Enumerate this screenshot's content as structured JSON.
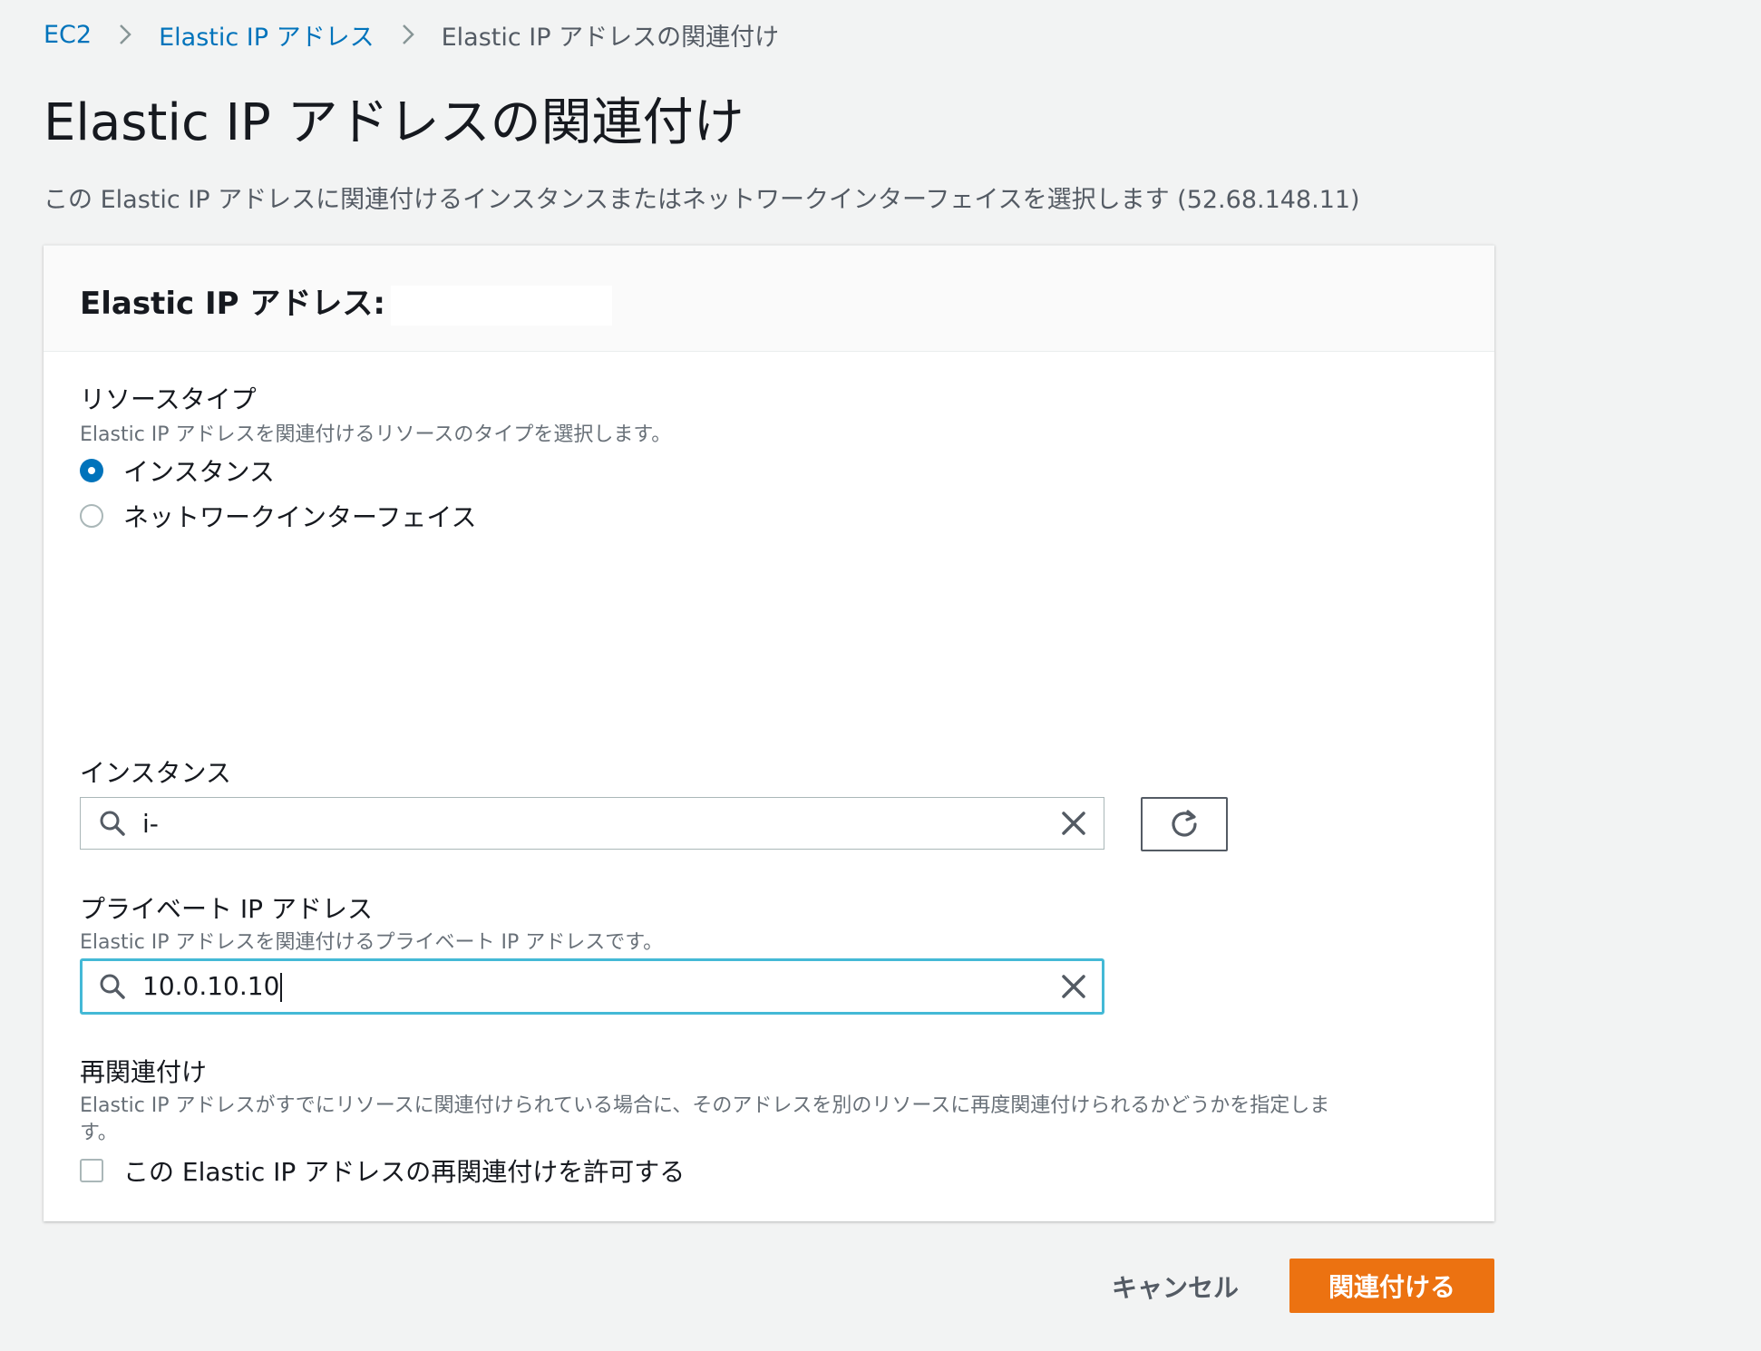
{
  "breadcrumb": {
    "items": [
      "EC2",
      "Elastic IP アドレス",
      "Elastic IP アドレスの関連付け"
    ]
  },
  "page": {
    "title": "Elastic IP アドレスの関連付け",
    "description": "この Elastic IP アドレスに関連付けるインスタンスまたはネットワークインターフェイスを選択します (52.68.148.11)"
  },
  "panel": {
    "title": "Elastic IP アドレス:"
  },
  "resource_type": {
    "label": "リソースタイプ",
    "description": "Elastic IP アドレスを関連付けるリソースのタイプを選択します。",
    "options": [
      "インスタンス",
      "ネットワークインターフェイス"
    ],
    "selected": "インスタンス"
  },
  "instance": {
    "label": "インスタンス",
    "value": "i-"
  },
  "private_ip": {
    "label": "プライベート IP アドレス",
    "description": "Elastic IP アドレスを関連付けるプライベート IP アドレスです。",
    "value": "10.0.10.10"
  },
  "reassociation": {
    "label": "再関連付け",
    "description_line1": "Elastic IP アドレスがすでにリソースに関連付けられている場合に、そのアドレスを別のリソースに再度関連付けられるかどうかを指定しま",
    "description_line2": "す。",
    "checkbox_label": "この Elastic IP アドレスの再関連付けを許可する",
    "checked": false
  },
  "actions": {
    "cancel": "キャンセル",
    "submit": "関連付ける"
  },
  "colors": {
    "link": "#0073bb",
    "primary": "#ec7211",
    "focus": "#44b9d6",
    "background": "#f2f3f3"
  }
}
